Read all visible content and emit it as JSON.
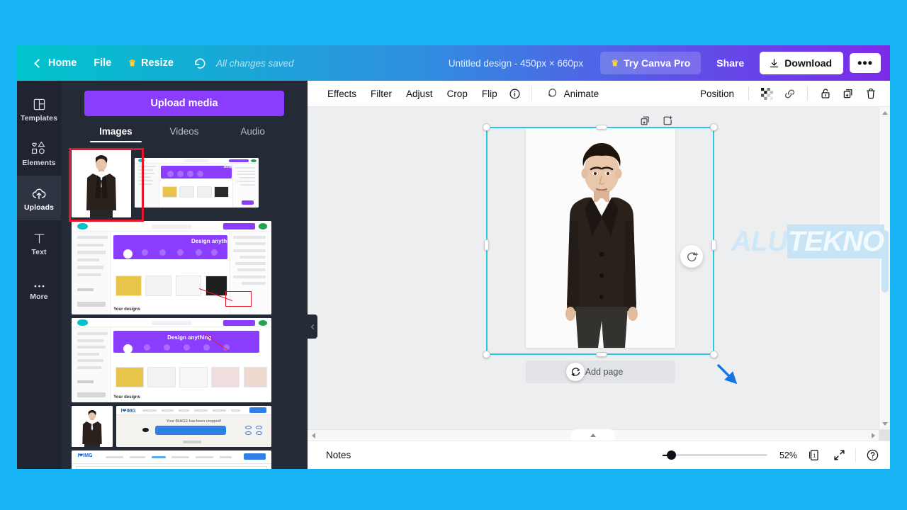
{
  "topbar": {
    "back_icon": "chevron-left-icon",
    "home_label": "Home",
    "file_label": "File",
    "resize_label": "Resize",
    "resize_icon": "crown-icon",
    "undo_icon": "undo-icon",
    "saved_status": "All changes saved",
    "doc_title": "Untitled design - 450px × 660px",
    "try_pro_label": "Try Canva Pro",
    "try_pro_icon": "crown-icon",
    "share_label": "Share",
    "download_label": "Download",
    "download_icon": "download-icon",
    "more_label": "•••",
    "gradient_start": "#00c4cc",
    "gradient_end": "#7d2ae8"
  },
  "rail": {
    "items": [
      {
        "label": "Templates",
        "icon": "templates-icon",
        "active": false
      },
      {
        "label": "Elements",
        "icon": "elements-icon",
        "active": false
      },
      {
        "label": "Uploads",
        "icon": "uploads-cloud-icon",
        "active": true
      },
      {
        "label": "Text",
        "icon": "text-t-icon",
        "active": false
      },
      {
        "label": "More",
        "icon": "more-dots-icon",
        "active": false
      }
    ]
  },
  "panel": {
    "upload_button": "Upload media",
    "tabs": [
      {
        "label": "Images",
        "active": true
      },
      {
        "label": "Videos",
        "active": false
      },
      {
        "label": "Audio",
        "active": false
      }
    ],
    "highlight_color": "#e8162a",
    "thumbnails": [
      {
        "name": "man-in-suit-photo",
        "kind": "portrait",
        "selected": true
      },
      {
        "name": "canva-homepage-screenshot-1",
        "kind": "canva-ui"
      },
      {
        "name": "canva-homepage-screenshot-2",
        "kind": "canva-ui"
      },
      {
        "name": "canva-homepage-screenshot-3",
        "kind": "canva-ui"
      },
      {
        "name": "man-in-suit-photo-2",
        "kind": "portrait"
      },
      {
        "name": "imgonline-cropped-screenshot",
        "kind": "imgonline"
      },
      {
        "name": "imgonline-page-screenshot",
        "kind": "imgonline"
      }
    ],
    "collapse_icon": "chevron-left-icon"
  },
  "editor_toolbar": {
    "items": [
      {
        "label": "Effects"
      },
      {
        "label": "Filter"
      },
      {
        "label": "Adjust"
      },
      {
        "label": "Crop"
      },
      {
        "label": "Flip"
      }
    ],
    "info_icon": "info-circle-icon",
    "animate_label": "Animate",
    "animate_icon": "animate-circles-icon",
    "position_label": "Position",
    "transparency_icon": "transparency-checker-icon",
    "link_icon": "link-icon",
    "lock_icon": "lock-icon",
    "duplicate_icon": "duplicate-icon",
    "delete_icon": "trash-icon"
  },
  "canvas": {
    "selection_color": "#2bc7e0",
    "add_page_label": "+ Add page",
    "magic_icon": "magic-edit-icon",
    "duplicate_page_icon": "duplicate-page-icon",
    "add_page_icon": "add-page-icon",
    "rotate_cursor_icon": "rotate-cursor-icon",
    "pointer_arrow_icon": "blue-arrow-icon",
    "watermark_part1": "ALU",
    "watermark_part2": "TEKNO"
  },
  "bottombar": {
    "notes_label": "Notes",
    "zoom_percent": "52%",
    "zoom_value": 52,
    "page_count_label": "1",
    "pages_icon": "page-manager-icon",
    "fullscreen_icon": "expand-icon",
    "help_icon": "help-circle-icon"
  }
}
